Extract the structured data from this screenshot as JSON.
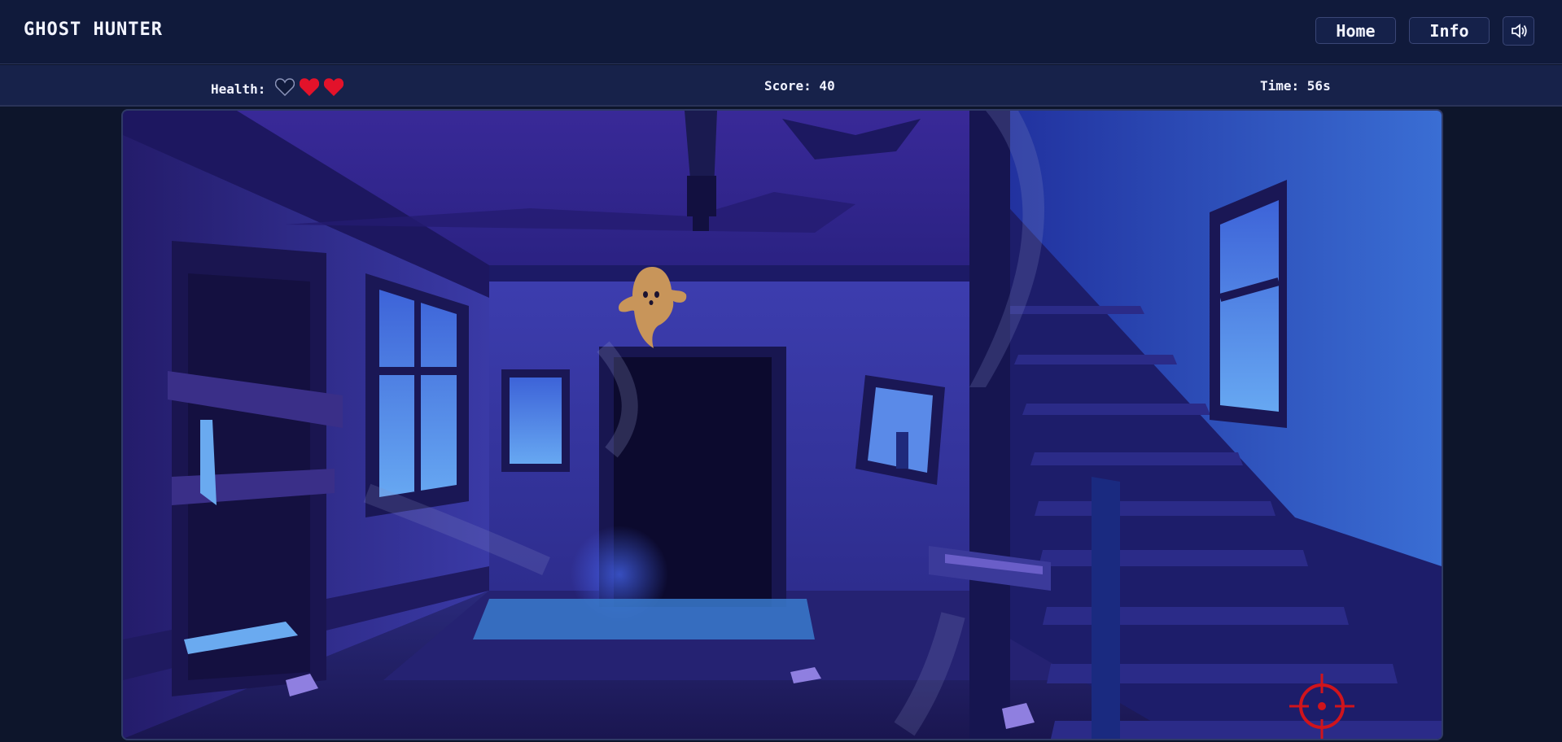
{
  "header": {
    "title": "GHOST HUNTER",
    "nav": {
      "home_label": "Home",
      "info_label": "Info"
    },
    "sound_icon": "speaker-icon"
  },
  "hud": {
    "health_label": "Health:",
    "health": {
      "current": 2,
      "max": 3
    },
    "score_text": "Score: 40",
    "time_text": "Time: 56s"
  },
  "scene": {
    "setting": "haunted-house-interior",
    "ghost_icon": "ghost-icon",
    "crosshair_icon": "crosshair-icon"
  },
  "colors": {
    "heart_full": "#e3122a",
    "heart_empty": "#101a3b",
    "crosshair": "#d0141c",
    "ghost": "#c8955a"
  }
}
